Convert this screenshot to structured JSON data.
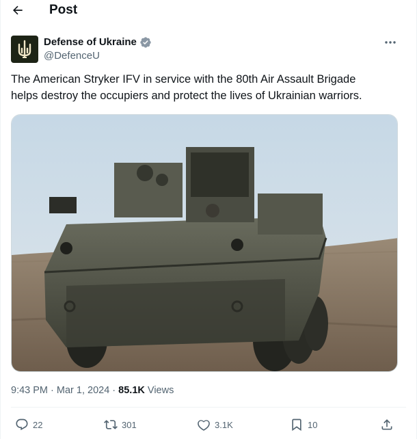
{
  "header": {
    "title": "Post"
  },
  "author": {
    "name": "Defense of Ukraine",
    "handle": "@DefenceU",
    "avatar_glyph": "Ш",
    "verified": true
  },
  "tweet": {
    "text_line1": "The American Stryker IFV in service with the 80th Air Assault Brigade",
    "text_line2": "helps destroy the occupiers and protect the lives of Ukrainian warriors."
  },
  "meta": {
    "time": "9:43 PM",
    "separator": " · ",
    "date": "Mar 1, 2024",
    "views_count": "85.1K",
    "views_label": " Views"
  },
  "actions": {
    "replies": "22",
    "reposts": "301",
    "likes": "3.1K",
    "bookmarks": "10"
  },
  "colors": {
    "text_primary": "#0f1419",
    "text_secondary": "#536471",
    "verified_blue": "#1d9bf0",
    "divider": "#eff3f4"
  },
  "icons": [
    "back-arrow-icon",
    "verified-badge-icon",
    "more-icon",
    "reply-icon",
    "repost-icon",
    "like-icon",
    "bookmark-icon",
    "share-icon"
  ]
}
